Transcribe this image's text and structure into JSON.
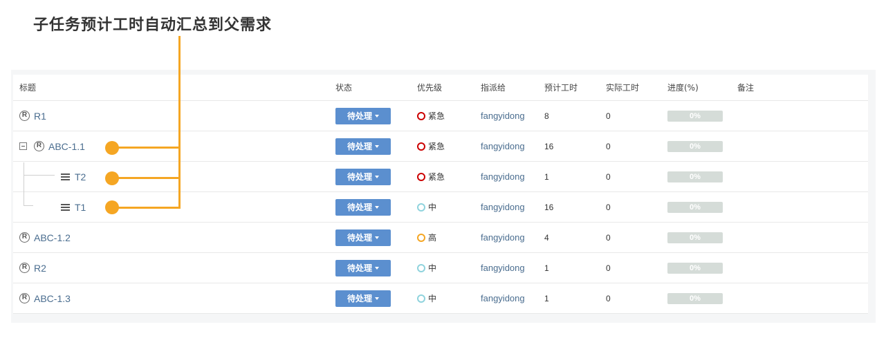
{
  "headline": "子任务预计工时自动汇总到父需求",
  "columns": {
    "title": "标题",
    "status": "状态",
    "priority": "优先级",
    "assignee": "指派给",
    "estimated": "预计工时",
    "actual": "实际工时",
    "progress": "进度(%)",
    "note": "备注"
  },
  "rows": [
    {
      "title": "R1",
      "type": "requirement",
      "status": "待处理",
      "priority": "紧急",
      "priority_color": "#cc0000",
      "assignee": "fangyidong",
      "estimated": "8",
      "actual": "0",
      "progress": "0%"
    },
    {
      "title": "ABC-1.1",
      "type": "requirement",
      "collapsible": true,
      "status": "待处理",
      "priority": "紧急",
      "priority_color": "#cc0000",
      "assignee": "fangyidong",
      "estimated": "16",
      "actual": "0",
      "progress": "0%"
    },
    {
      "title": "T2",
      "type": "task",
      "status": "待处理",
      "priority": "紧急",
      "priority_color": "#cc0000",
      "assignee": "fangyidong",
      "estimated": "1",
      "actual": "0",
      "progress": "0%"
    },
    {
      "title": "T1",
      "type": "task",
      "status": "待处理",
      "priority": "中",
      "priority_color": "#8fd3dd",
      "assignee": "fangyidong",
      "estimated": "16",
      "actual": "0",
      "progress": "0%"
    },
    {
      "title": "ABC-1.2",
      "type": "requirement",
      "status": "待处理",
      "priority": "高",
      "priority_color": "#f5a623",
      "assignee": "fangyidong",
      "estimated": "4",
      "actual": "0",
      "progress": "0%"
    },
    {
      "title": "R2",
      "type": "requirement",
      "status": "待处理",
      "priority": "中",
      "priority_color": "#8fd3dd",
      "assignee": "fangyidong",
      "estimated": "1",
      "actual": "0",
      "progress": "0%"
    },
    {
      "title": "ABC-1.3",
      "type": "requirement",
      "status": "待处理",
      "priority": "中",
      "priority_color": "#8fd3dd",
      "assignee": "fangyidong",
      "estimated": "1",
      "actual": "0",
      "progress": "0%"
    }
  ],
  "colors": {
    "accent": "#5b8fcf",
    "annotation": "#f5a623",
    "link": "#4a6d8f",
    "progress_bg": "#d5dcd8"
  }
}
